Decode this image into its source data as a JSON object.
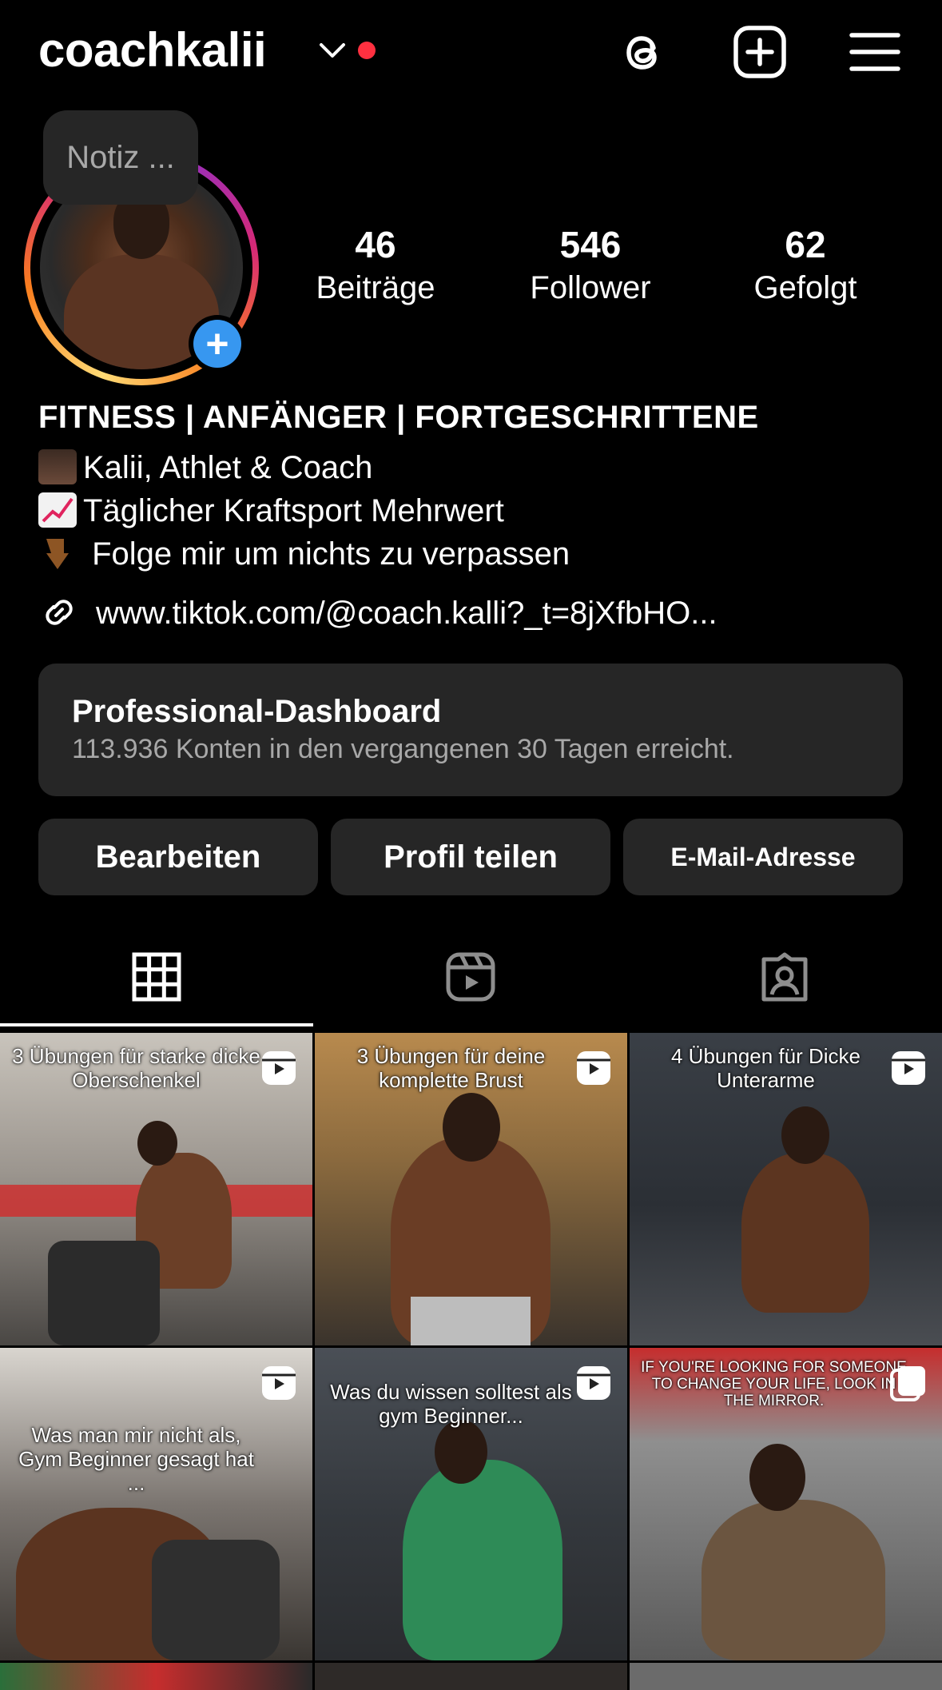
{
  "header": {
    "username": "coachkalii",
    "icons": [
      "chevron-down-icon",
      "notification-dot",
      "threads-icon",
      "new-post-icon",
      "menu-icon"
    ]
  },
  "profile": {
    "note_placeholder": "Notiz ...",
    "stats": [
      {
        "value": "46",
        "label": "Beiträge"
      },
      {
        "value": "546",
        "label": "Follower"
      },
      {
        "value": "62",
        "label": "Gefolgt"
      }
    ]
  },
  "bio": {
    "title": "FITNESS | ANFÄNGER | FORTGESCHRITTENE",
    "lines": [
      {
        "emoji": "weightlifter",
        "text": "Kalii, Athlet & Coach"
      },
      {
        "emoji": "chart-increasing",
        "text": "Täglicher Kraftsport Mehrwert"
      },
      {
        "emoji": "pointing-down",
        "text": " Folge mir um nichts zu verpassen"
      }
    ],
    "link": "www.tiktok.com/@coach.kalli?_t=8jXfbHO..."
  },
  "dashboard": {
    "title": "Professional-Dashboard",
    "subtitle": "113.936 Konten in den vergangenen 30 Tagen erreicht."
  },
  "buttons": {
    "edit": "Bearbeiten",
    "share": "Profil teilen",
    "email": "E-Mail-Adresse"
  },
  "tabs": [
    "grid-icon",
    "reels-icon",
    "tagged-icon"
  ],
  "posts": [
    {
      "caption": "3 Übungen für starke dicke Oberschenkel",
      "badge": "reel"
    },
    {
      "caption": "3 Übungen für deine komplette Brust",
      "badge": "reel"
    },
    {
      "caption": "4 Übungen für Dicke Unterarme",
      "badge": "reel"
    },
    {
      "caption": "Was man mir nicht als, Gym Beginner gesagt hat ...",
      "badge": "reel"
    },
    {
      "caption": "Was du wissen solltest als gym Beginner...",
      "badge": "reel"
    },
    {
      "caption": "IF YOU'RE LOOKING FOR SOMEONE TO CHANGE YOUR LIFE, LOOK IN THE MIRROR.",
      "badge": "carousel"
    }
  ],
  "colors": {
    "accent": "#3797f0",
    "notification": "#ff3040",
    "surface": "#262626",
    "secondary_text": "#a8a8a8"
  }
}
